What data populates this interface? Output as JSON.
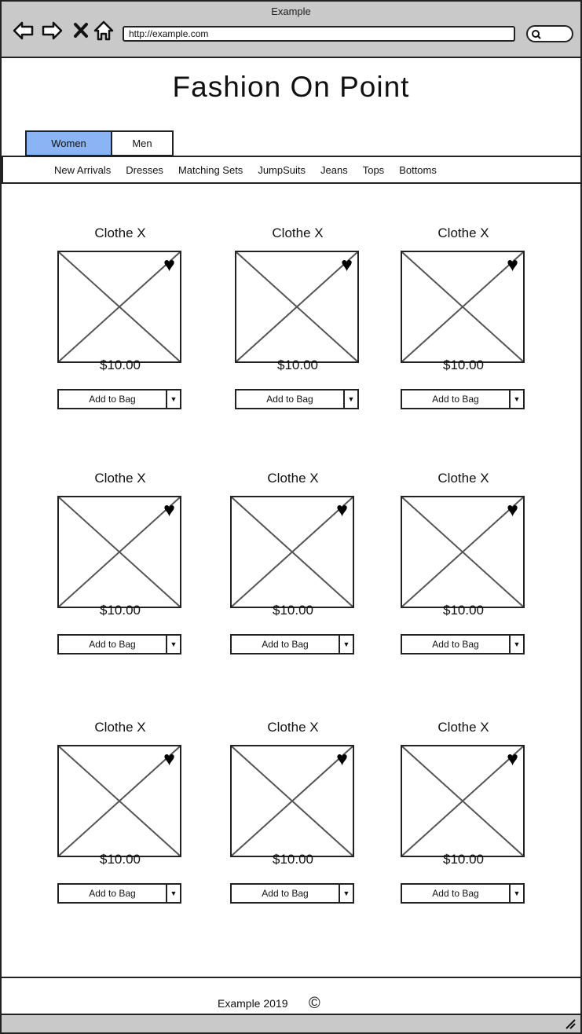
{
  "window": {
    "title": "Example",
    "url": "http://example.com"
  },
  "site": {
    "title": "Fashion On Point"
  },
  "gender_tabs": [
    {
      "label": "Women",
      "active": true
    },
    {
      "label": "Men",
      "active": false
    }
  ],
  "categories": [
    "New Arrivals",
    "Dresses",
    "Matching Sets",
    "JumpSuits",
    "Jeans",
    "Tops",
    "Bottoms"
  ],
  "products": [
    {
      "name": "Clothe X",
      "price": "$10.00",
      "button": "Add to Bag",
      "favorite_icon": "heart-icon"
    },
    {
      "name": "Clothe X",
      "price": "$10.00",
      "button": "Add to Bag",
      "favorite_icon": "heart-icon"
    },
    {
      "name": "Clothe X",
      "price": "$10.00",
      "button": "Add to Bag",
      "favorite_icon": "heart-icon"
    },
    {
      "name": "Clothe X",
      "price": "$10.00",
      "button": "Add to Bag",
      "favorite_icon": "heart-icon"
    },
    {
      "name": "Clothe X",
      "price": "$10.00",
      "button": "Add to Bag",
      "favorite_icon": "heart-icon"
    },
    {
      "name": "Clothe X",
      "price": "$10.00",
      "button": "Add to Bag",
      "favorite_icon": "heart-icon"
    },
    {
      "name": "Clothe X",
      "price": "$10.00",
      "button": "Add to Bag",
      "favorite_icon": "heart-icon"
    },
    {
      "name": "Clothe X",
      "price": "$10.00",
      "button": "Add to Bag",
      "favorite_icon": "heart-icon"
    },
    {
      "name": "Clothe X",
      "price": "$10.00",
      "button": "Add to Bag",
      "favorite_icon": "heart-icon"
    }
  ],
  "footer": {
    "text": "Example 2019",
    "icon": "copyright-icon"
  },
  "colors": {
    "chrome": "#c9c9c9",
    "active_tab": "#8ab4f4",
    "border": "#222222"
  }
}
